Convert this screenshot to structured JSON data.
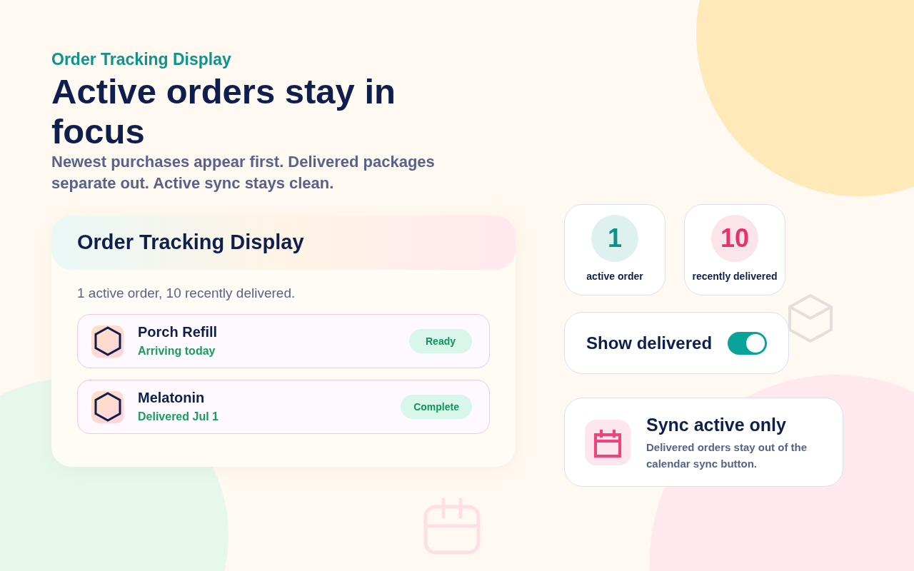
{
  "eyebrow": "Order Tracking Display",
  "title": "Active orders stay in focus",
  "subtitle": "Newest purchases appear first. Delivered packages separate out. Active sync stays clean.",
  "card": {
    "title": "Order Tracking Display",
    "summary": "1 active order, 10 recently delivered.",
    "orders": [
      {
        "name": "Porch Refill",
        "detail": "Arriving today",
        "status": "Ready"
      },
      {
        "name": "Melatonin",
        "detail": "Delivered Jul 1",
        "status": "Complete"
      }
    ]
  },
  "stats": [
    {
      "value": "1",
      "label": "active order",
      "color": "#0d9488"
    },
    {
      "value": "10",
      "label": "recently delivered",
      "color": "#e5336b"
    }
  ],
  "toggle": {
    "label": "Show delivered",
    "on": true
  },
  "sync": {
    "title": "Sync active only",
    "description": "Delivered orders stay out of the calendar sync button."
  }
}
